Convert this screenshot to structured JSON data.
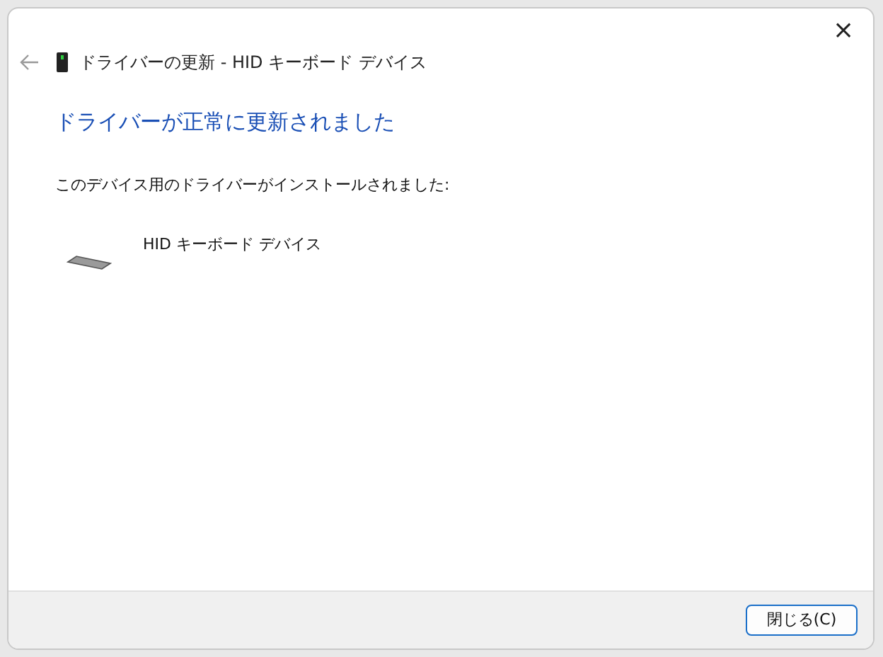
{
  "window": {
    "title": "ドライバーの更新 - HID キーボード デバイス",
    "close": "×"
  },
  "heading": "ドライバーが正常に更新されました",
  "message": "このデバイス用のドライバーがインストールされました:",
  "device": {
    "name": "HID キーボード デバイス"
  },
  "buttons": [
    "閉じる(C)"
  ]
}
